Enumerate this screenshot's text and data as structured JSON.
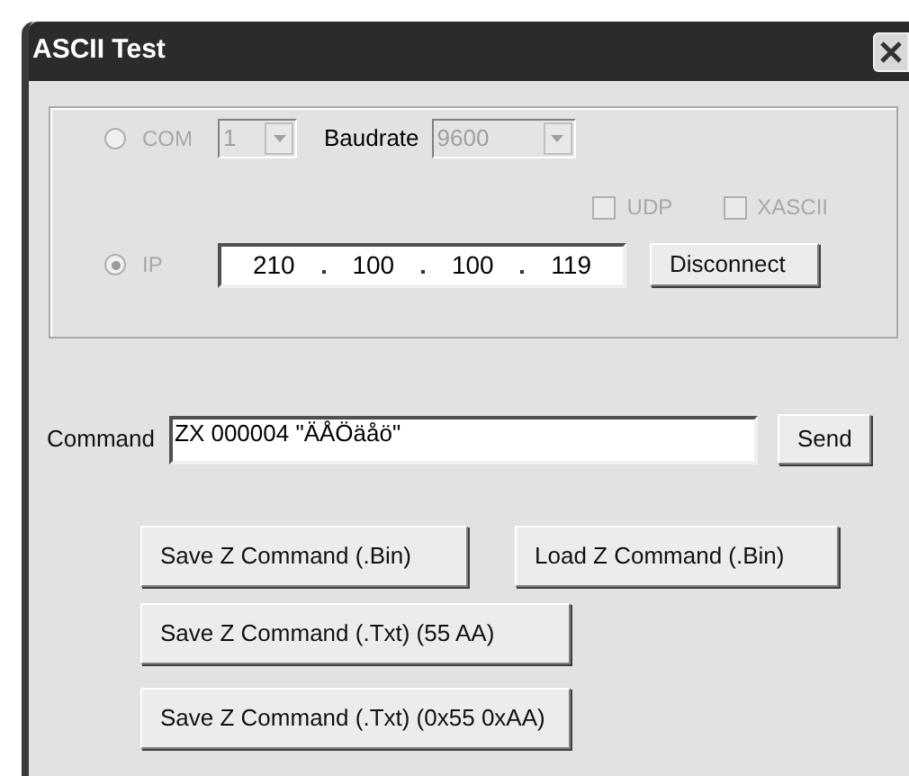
{
  "window": {
    "title": "ASCII Test"
  },
  "connection": {
    "com": {
      "label": "COM",
      "selected": false,
      "disabled": true
    },
    "port": {
      "value": "1",
      "disabled": true
    },
    "baudrate": {
      "label": "Baudrate",
      "value": "9600",
      "disabled": true
    },
    "options": [
      {
        "label": "UDP",
        "checked": false,
        "disabled": true
      },
      {
        "label": "XASCII",
        "checked": false,
        "disabled": true
      }
    ],
    "ip": {
      "label": "IP",
      "selected": true,
      "disabled": true
    },
    "address": [
      "210",
      "100",
      "100",
      "119"
    ],
    "connect_button": "Disconnect"
  },
  "command": {
    "label": "Command",
    "value": "ZX 000004 \"ÄÅÖäåö\"",
    "send_button": "Send"
  },
  "buttons": [
    [
      "Save Z Command (.Bin)",
      "Load Z Command (.Bin)"
    ],
    [
      "Save Z Command (.Txt) (55 AA)"
    ],
    [
      "Save Z Command (.Txt) (0x55 0xAA)"
    ]
  ]
}
